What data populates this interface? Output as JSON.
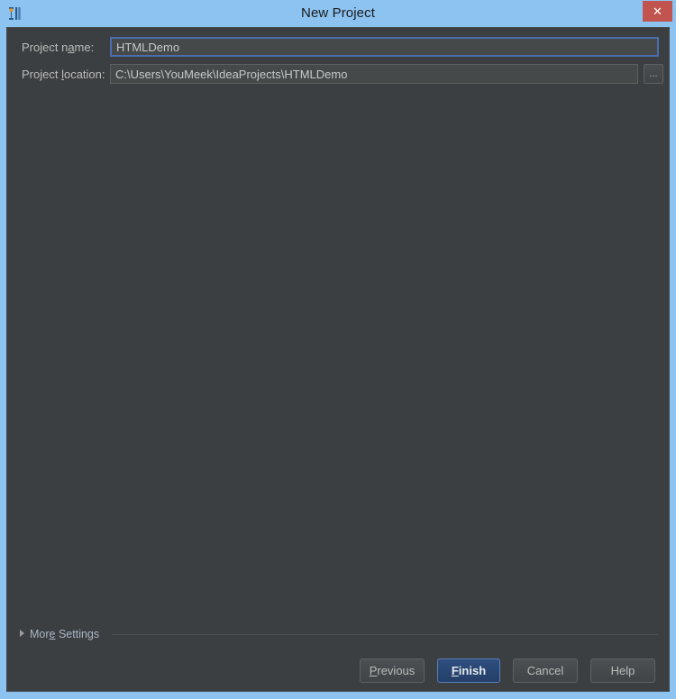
{
  "window": {
    "title": "New Project",
    "app_icon": "intellij-idea-logo-icon",
    "close_label": "✕",
    "frame_color": "#8CC3F0",
    "client_background": "#3C3F41"
  },
  "form": {
    "name_row": {
      "label_prefix": "Project n",
      "label_mnemonic": "a",
      "label_suffix": "me:",
      "value": "HTMLDemo",
      "placeholder": "",
      "focused": true,
      "focus_border_color": "#4B6EAF"
    },
    "location_row": {
      "label_prefix": "Project ",
      "label_mnemonic": "l",
      "label_suffix": "ocation:",
      "value": "C:\\Users\\YouMeek\\IdeaProjects\\HTMLDemo",
      "placeholder": "",
      "browse_label": "...",
      "browse_icon": "ellipsis-icon"
    }
  },
  "more_settings": {
    "prefix": "Mor",
    "mnemonic": "e",
    "suffix": " Settings",
    "expanded": false,
    "disclosure_icon": "triangle-right-icon"
  },
  "footer": {
    "buttons": [
      {
        "prefix": "",
        "mnemonic": "P",
        "suffix": "revious",
        "default": false
      },
      {
        "prefix": "",
        "mnemonic": "F",
        "suffix": "inish",
        "default": true
      },
      {
        "prefix": "C",
        "mnemonic": "",
        "suffix": "ancel",
        "default": false
      },
      {
        "prefix": "H",
        "mnemonic": "",
        "suffix": "elp",
        "default": false
      }
    ],
    "default_button_color": "#2E4E7E"
  }
}
